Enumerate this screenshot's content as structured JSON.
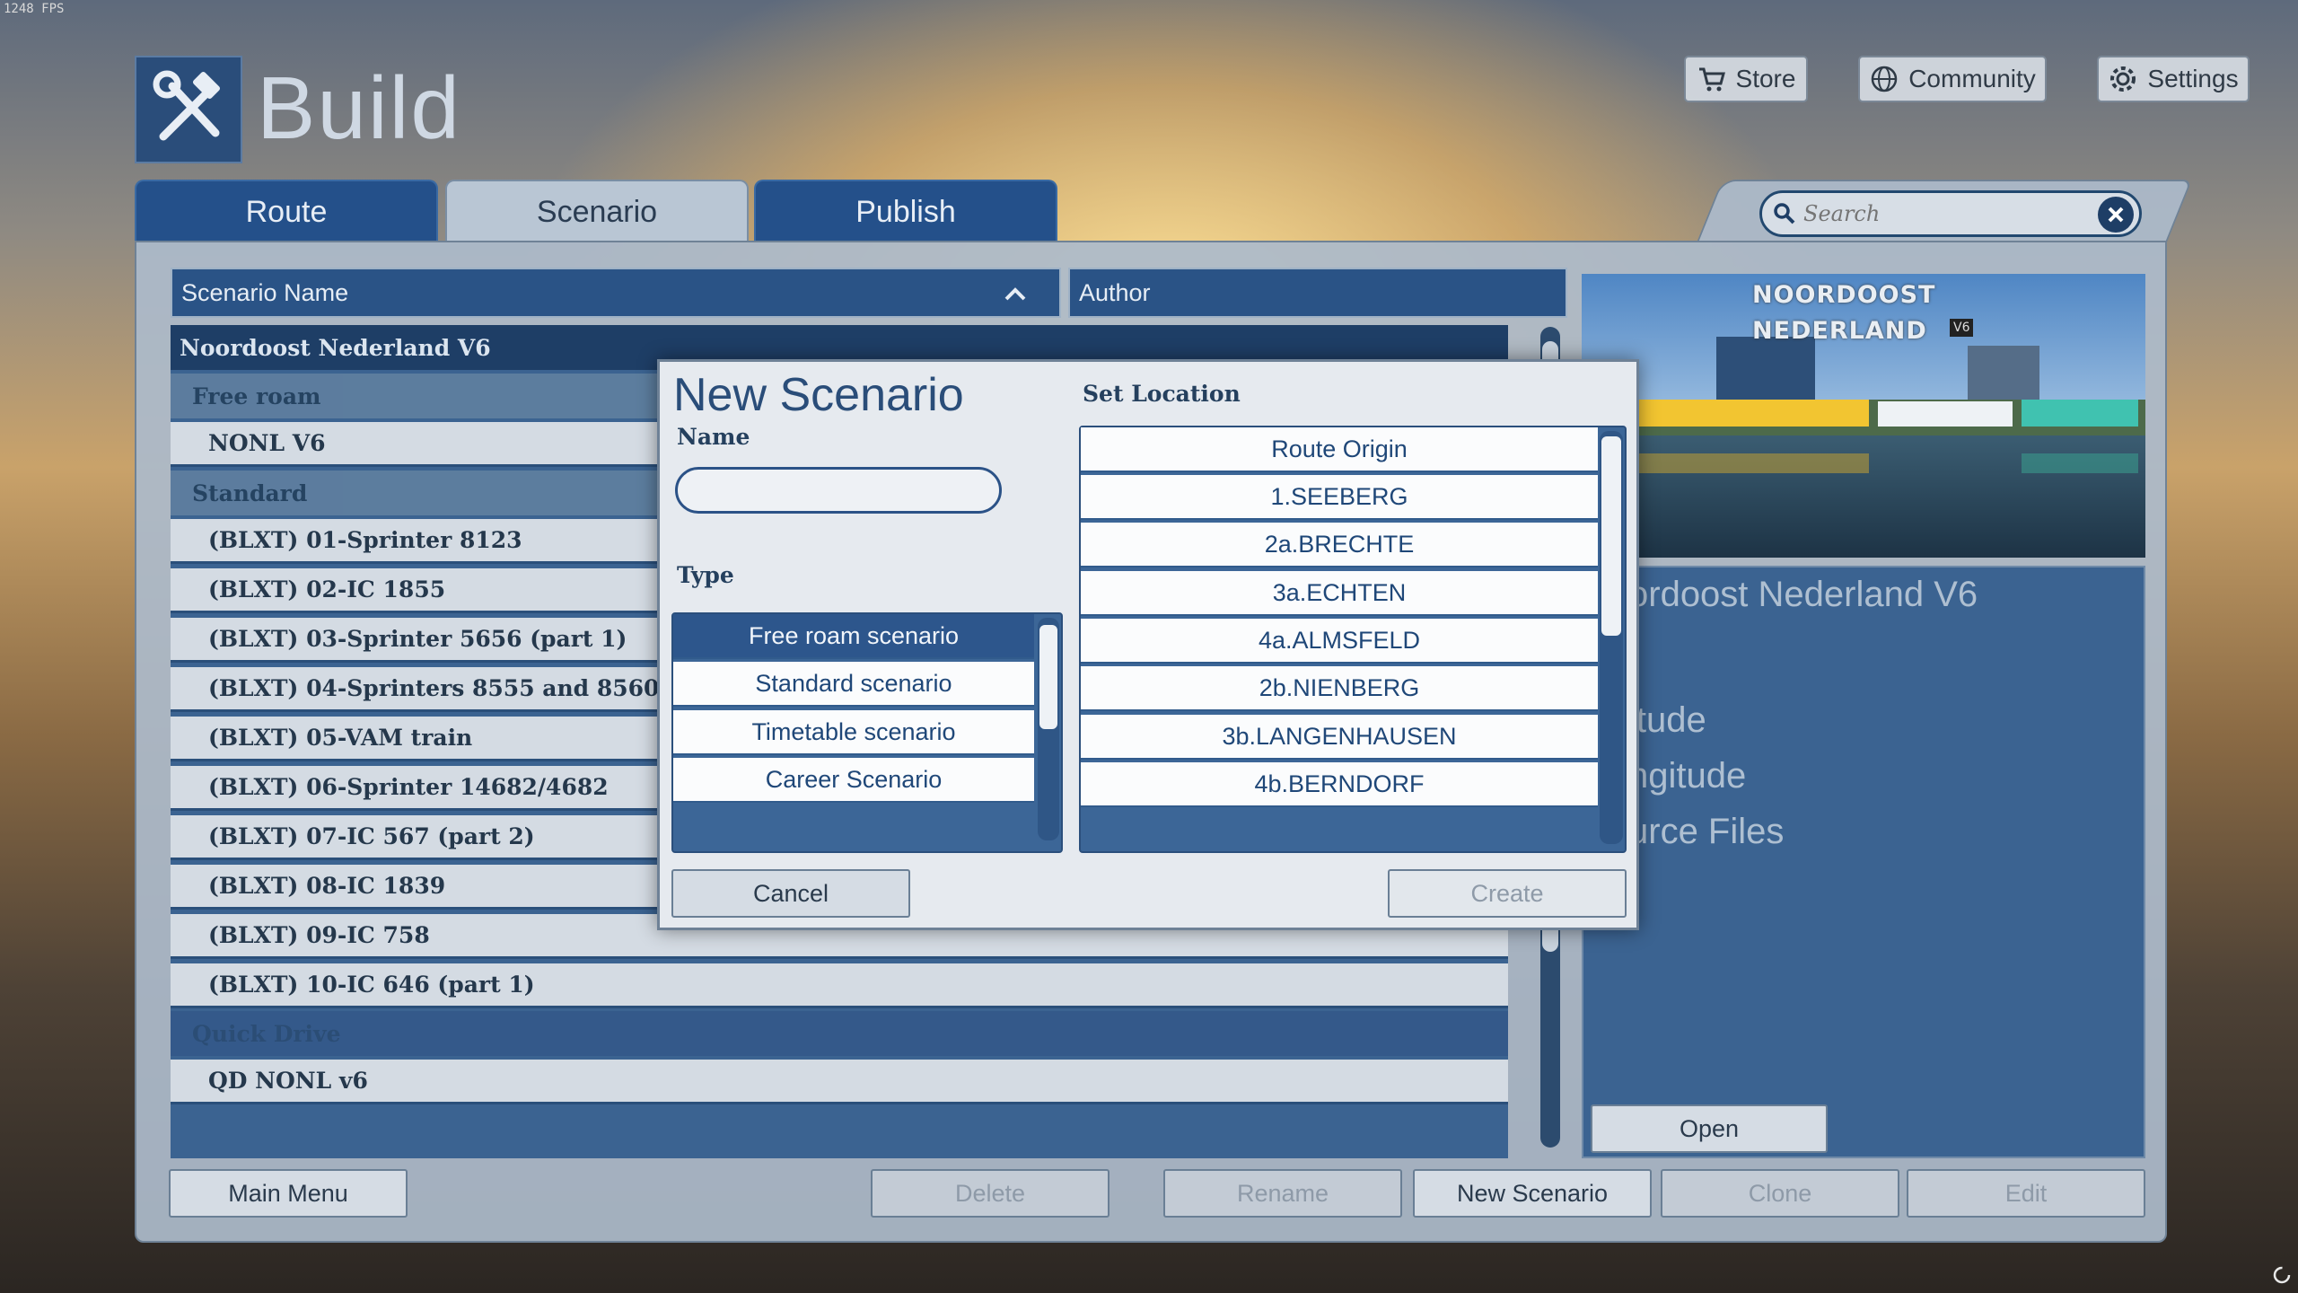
{
  "fps": "1248 FPS",
  "header": {
    "title": "Build",
    "store_label": "Store",
    "community_label": "Community",
    "settings_label": "Settings"
  },
  "tabs": [
    {
      "label": "Route"
    },
    {
      "label": "Scenario"
    },
    {
      "label": "Publish"
    }
  ],
  "search": {
    "placeholder": "Search",
    "value": ""
  },
  "columns": {
    "name": "Scenario Name",
    "author": "Author"
  },
  "list": {
    "route": "Noordoost Nederland V6",
    "free_roam": "Free roam",
    "free_roam_items": [
      "NONL V6"
    ],
    "standard": "Standard",
    "standard_items": [
      "(BLXT) 01-Sprinter 8123",
      "(BLXT) 02-IC 1855",
      "(BLXT) 03-Sprinter 5656 (part 1)",
      "(BLXT) 04-Sprinters 8555 and 8560",
      "(BLXT) 05-VAM train",
      "(BLXT) 06-Sprinter 14682/4682",
      "(BLXT) 07-IC 567 (part 2)",
      "(BLXT) 08-IC 1839",
      "(BLXT) 09-IC 758",
      "(BLXT) 10-IC 646 (part 1)"
    ],
    "quick_drive": "Quick Drive",
    "quick_drive_items": [
      "QD NONL v6"
    ]
  },
  "preview": {
    "line1": "NOORDOOST",
    "line2": "NEDERLAND",
    "badge": "V6"
  },
  "info": {
    "title_fragment": "ordoost Nederland V6",
    "latitude_fragment": "itude",
    "longitude_fragment": "ngitude",
    "source_files_fragment": "urce Files",
    "open_label": "Open"
  },
  "bottom_buttons": {
    "main_menu": "Main Menu",
    "delete": "Delete",
    "rename": "Rename",
    "new_scenario": "New Scenario",
    "clone": "Clone",
    "edit": "Edit"
  },
  "dialog": {
    "title": "New Scenario",
    "name_label": "Name",
    "name_value": "",
    "type_label": "Type",
    "types": [
      "Free roam scenario",
      "Standard scenario",
      "Timetable scenario",
      "Career Scenario"
    ],
    "selected_type": "Free roam scenario",
    "location_label": "Set Location",
    "locations": [
      "Route Origin",
      "1.SEEBERG",
      "2a.BRECHTE",
      "3a.ECHTEN",
      "4a.ALMSFELD",
      "2b.NIENBERG",
      "3b.LANGENHAUSEN",
      "4b.BERNDORF"
    ],
    "cancel_label": "Cancel",
    "create_label": "Create"
  },
  "colors": {
    "accent": "#24508a",
    "dark_blue": "#1e3e66",
    "panel": "#acbaca"
  }
}
